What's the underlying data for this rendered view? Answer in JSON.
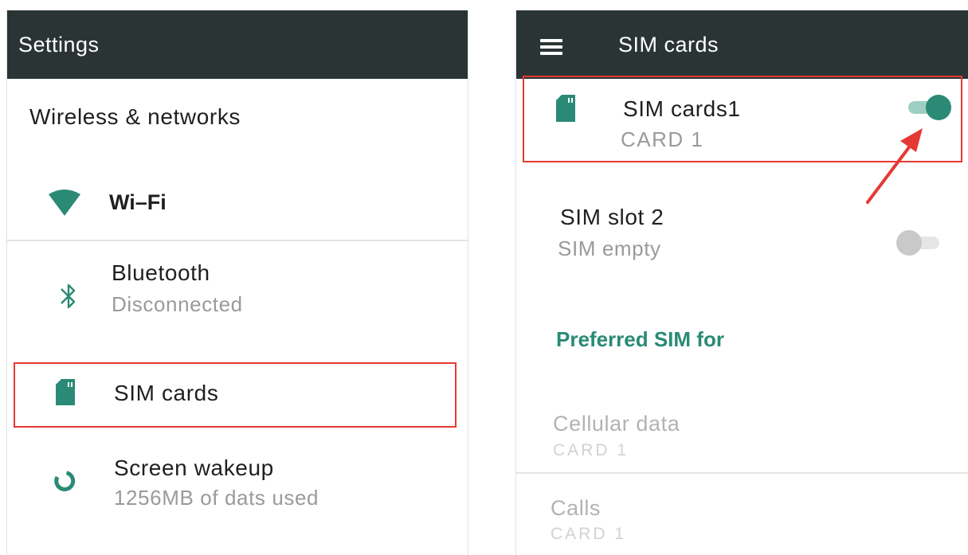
{
  "colors": {
    "appbar": "#2a3434",
    "accent": "#2a8a76",
    "highlight": "#e53935",
    "arrow": "#e53935"
  },
  "settings": {
    "title": "Settings",
    "section_header": "Wireless & networks",
    "items": [
      {
        "icon": "wifi-icon",
        "title": "Wi–Fi"
      },
      {
        "icon": "bluetooth-icon",
        "title": "Bluetooth",
        "subtitle": "Disconnected"
      },
      {
        "icon": "sim-card-icon",
        "title": "SIM  cards"
      },
      {
        "icon": "screen-wakeup-icon",
        "title": "Screen wakeup",
        "subtitle": "1256MB of dats used"
      }
    ]
  },
  "sim_cards": {
    "title": "SIM  cards",
    "menu_icon": "menu-icon",
    "slots": [
      {
        "icon": "sim-card-icon",
        "title": "SIM  cards1",
        "subtitle": "CARD  1",
        "enabled": true
      },
      {
        "title": "SIM  slot 2",
        "subtitle": "SIM empty",
        "enabled": false
      }
    ],
    "preferred_header": "Preferred SIM for",
    "preferred": [
      {
        "title": "Cellular data",
        "value": "CARD  1"
      },
      {
        "title": "Calls",
        "value": "CARD  1"
      }
    ]
  }
}
